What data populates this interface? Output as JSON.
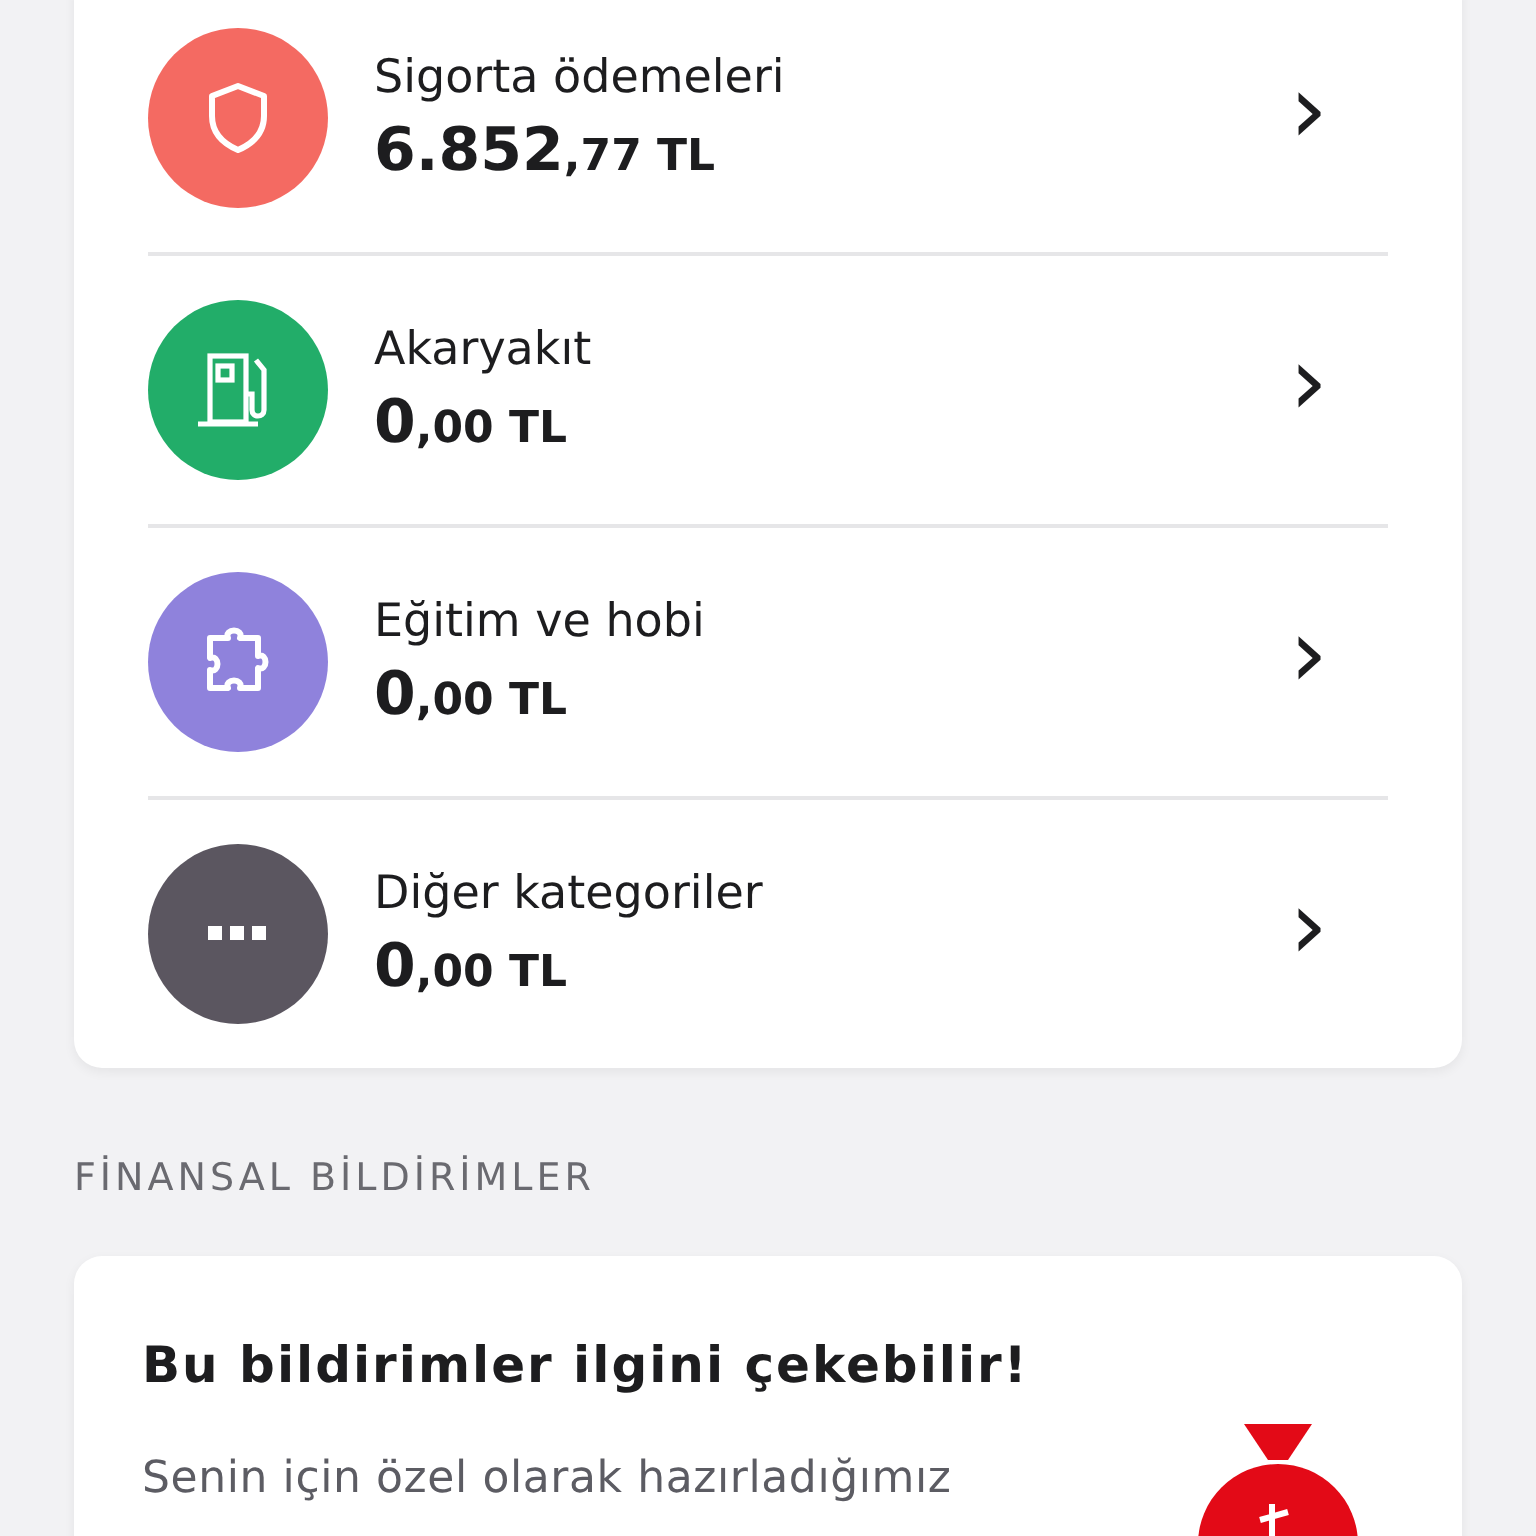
{
  "categories": [
    {
      "kind": "shield",
      "name": "Sigorta ödemeleri",
      "amount_main": "6.852",
      "amount_fraction": ",77",
      "currency": "TL",
      "color": "#f46a62",
      "chevron": "›"
    },
    {
      "kind": "fuel",
      "name": "Akaryakıt",
      "amount_main": "0",
      "amount_fraction": ",00",
      "currency": "TL",
      "color": "#22ad69",
      "chevron": "›"
    },
    {
      "kind": "puzzle",
      "name": "Eğitim ve hobi",
      "amount_main": "0",
      "amount_fraction": ",00",
      "currency": "TL",
      "color": "#8f82dc",
      "chevron": "›"
    },
    {
      "kind": "more",
      "name": "Diğer kategoriler",
      "amount_main": "0",
      "amount_fraction": ",00",
      "currency": "TL",
      "color": "#5b5660",
      "chevron": "›"
    }
  ],
  "section_title": "FİNANSAL BİLDİRİMLER",
  "notification_card": {
    "title": "Bu bildirimler ilgini çekebilir!",
    "body": "Senin için özel olarak hazırladığımız"
  }
}
